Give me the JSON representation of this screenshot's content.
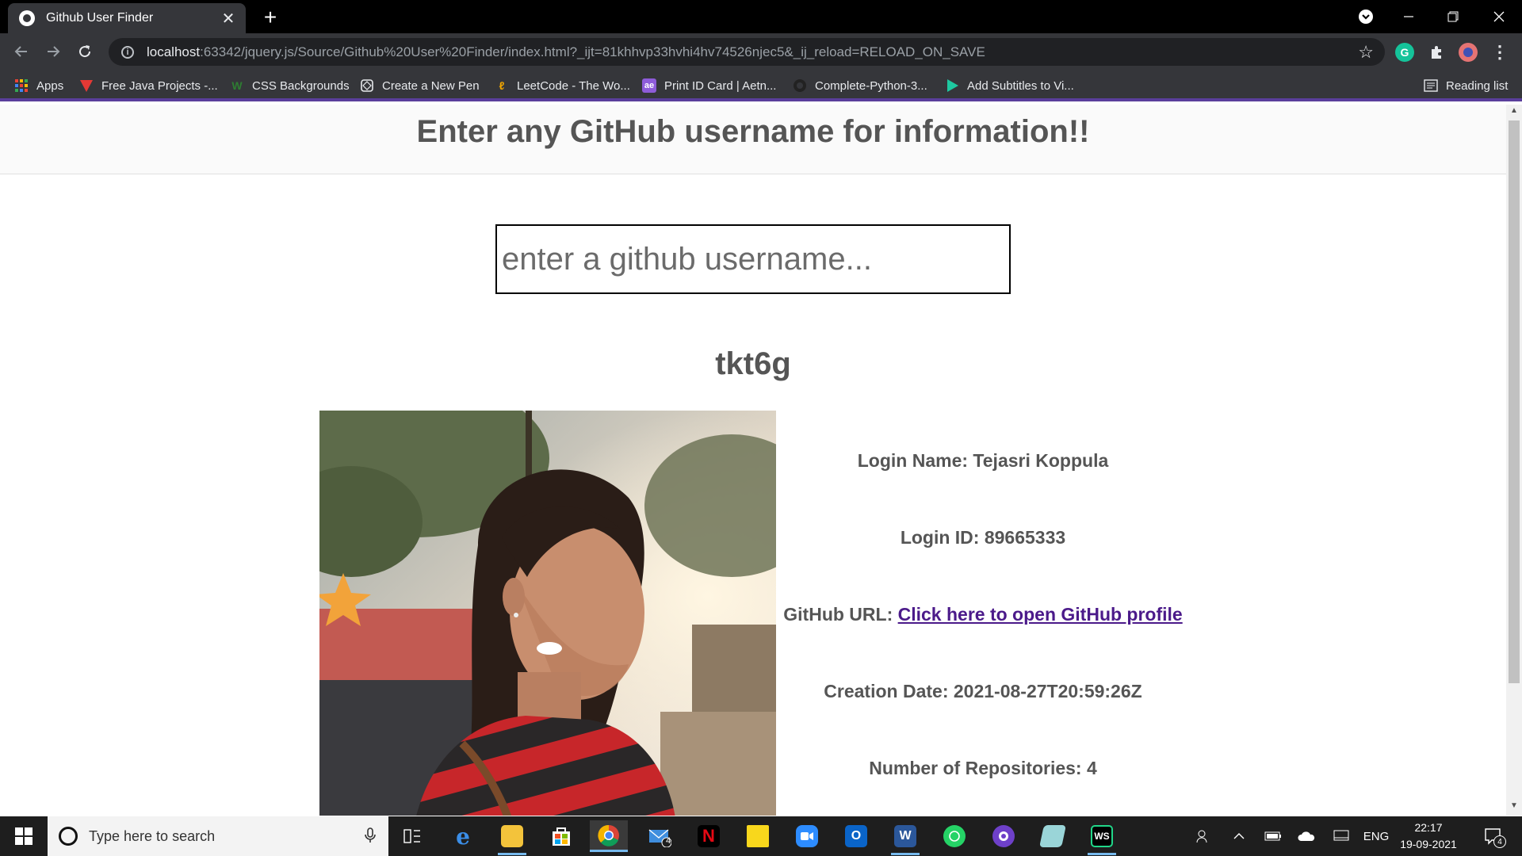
{
  "browser": {
    "tab_title": "Github User Finder",
    "close_glyph": "✕",
    "new_tab_glyph": "+",
    "url_host": "localhost",
    "url_path": ":63342/jquery.js/Source/Github%20User%20Finder/index.html?_ijt=81khhvp33hvhi4hv74526njec5&_ij_reload=RELOAD_ON_SAVE",
    "reading_list": "Reading list",
    "bookmarks": [
      {
        "label": "Apps",
        "icon": "apps-grid-icon",
        "color": "#ea4335"
      },
      {
        "label": "Free Java Projects -...",
        "icon": "red-triangle-icon",
        "color": "#e53935"
      },
      {
        "label": "CSS Backgrounds",
        "icon": "w-logo-icon",
        "color": "#2e7d32"
      },
      {
        "label": "Create a New Pen",
        "icon": "codepen-icon",
        "color": "#e8eaed"
      },
      {
        "label": "LeetCode - The Wo...",
        "icon": "leetcode-icon",
        "color": "#f0a500"
      },
      {
        "label": "Print ID Card | Aetn...",
        "icon": "idcard-icon",
        "color": "#8e5cd9"
      },
      {
        "label": "Complete-Python-3...",
        "icon": "github-icon",
        "color": "#222222"
      },
      {
        "label": "Add Subtitles to Vi...",
        "icon": "play-icon",
        "color": "#1ec8a0"
      }
    ]
  },
  "page": {
    "header": "Enter any GitHub username for information!!",
    "search_placeholder": "enter a github username...",
    "username": "tkt6g",
    "login_name_label": "Login Name:",
    "login_name": "Tejasri Koppula",
    "login_id_label": "Login ID:",
    "login_id": "89665333",
    "github_url_label": "GitHub URL:",
    "github_url_link": "Click here to open GitHub profile",
    "creation_date_label": "Creation Date:",
    "creation_date": "2021-08-27T20:59:26Z",
    "repos_label": "Number of Repositories:",
    "repos": "4"
  },
  "taskbar": {
    "search_placeholder": "Type here to search",
    "language": "ENG",
    "time": "22:17",
    "date": "19-09-2021",
    "mail_badge": "4",
    "notification_badge": "4"
  },
  "colors": {
    "chrome_dark": "#35363a",
    "link": "#4b1a8a",
    "heading_text": "#555555",
    "accent_line": "#5a3e9b"
  }
}
